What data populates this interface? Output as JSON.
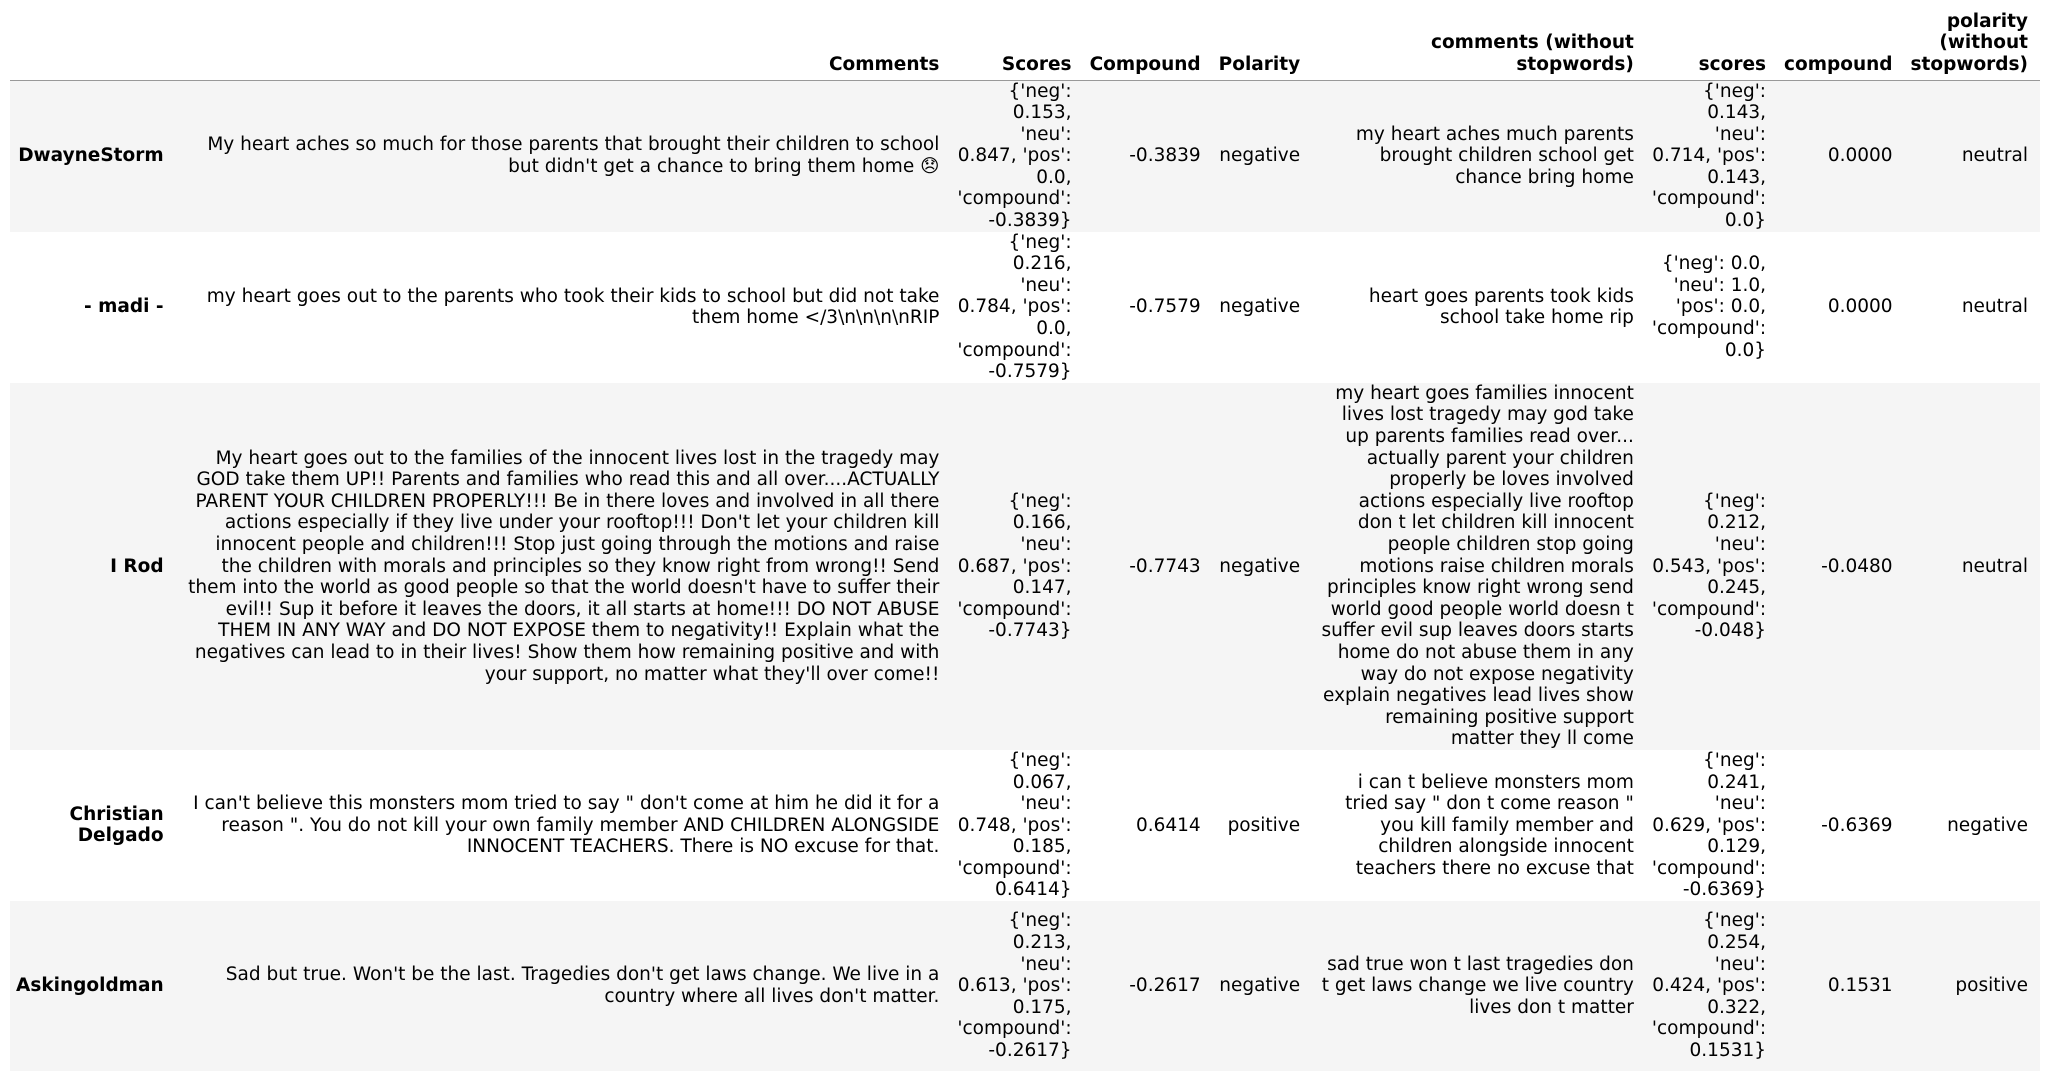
{
  "table": {
    "columns": [
      "Comments",
      "Scores",
      "Compound",
      "Polarity",
      "comments (without stopwords)",
      "scores",
      "compound",
      "polarity (without stopwords)"
    ],
    "rows": [
      {
        "index": "DwayneStorm",
        "comments": "My heart aches so much for those parents that brought their children to school but didn't get a chance to bring them home 😞",
        "scores": "{'neg': 0.153, 'neu': 0.847, 'pos': 0.0, 'compound': -0.3839}",
        "compound": "-0.3839",
        "polarity": "negative",
        "comments_ws": "my heart aches much parents brought children school get chance bring home",
        "scores_ws": "{'neg': 0.143, 'neu': 0.714, 'pos': 0.143, 'compound': 0.0}",
        "compound_ws": "0.0000",
        "polarity_ws": "neutral"
      },
      {
        "index": "- madi -",
        "comments": "my heart goes out to the parents who took their kids to school but did not take them home </3\\n\\n\\n\\nRIP",
        "scores": "{'neg': 0.216, 'neu': 0.784, 'pos': 0.0, 'compound': -0.7579}",
        "compound": "-0.7579",
        "polarity": "negative",
        "comments_ws": "heart goes parents took kids school take home rip",
        "scores_ws": "{'neg': 0.0, 'neu': 1.0, 'pos': 0.0, 'compound': 0.0}",
        "compound_ws": "0.0000",
        "polarity_ws": "neutral"
      },
      {
        "index": "I Rod",
        "comments": "My heart goes out to the families of the innocent lives lost in the tragedy may GOD take them UP!! Parents and families who read this and all over....ACTUALLY PARENT YOUR CHILDREN PROPERLY!!! Be in there loves and involved in all there actions especially if they live under your rooftop!!! Don't let your children kill innocent people and children!!! Stop just going through the motions and raise the children with morals and principles so they know right from wrong!! Send them into the world as good people so that the world doesn't have to suffer their evil!! Sup it before it leaves the doors, it all starts at home!!! DO NOT ABUSE THEM IN ANY WAY and DO NOT EXPOSE them to negativity!! Explain what the negatives can lead to in their lives! Show them how remaining positive and with your support, no matter what they'll over come!!",
        "scores": "{'neg': 0.166, 'neu': 0.687, 'pos': 0.147, 'compound': -0.7743}",
        "compound": "-0.7743",
        "polarity": "negative",
        "comments_ws": "my heart goes families innocent lives lost tragedy may god take up parents families read over... actually parent your children properly be loves involved actions especially live rooftop don t let children kill innocent people children stop going motions raise children morals principles know right wrong send world good people world doesn t suffer evil sup leaves doors starts home do not abuse them in any way do not expose negativity explain negatives lead lives show remaining positive support matter they ll come",
        "scores_ws": "{'neg': 0.212, 'neu': 0.543, 'pos': 0.245, 'compound': -0.048}",
        "compound_ws": "-0.0480",
        "polarity_ws": "neutral"
      },
      {
        "index": "Christian Delgado",
        "comments": "I can't believe this monsters mom tried to say \" don't come at him he did it for a reason \". You do not kill your own family member AND CHILDREN ALONGSIDE INNOCENT TEACHERS. There is NO excuse for that.",
        "scores": "{'neg': 0.067, 'neu': 0.748, 'pos': 0.185, 'compound': 0.6414}",
        "compound": "0.6414",
        "polarity": "positive",
        "comments_ws": "i can t believe monsters mom tried say \" don t come reason \" you kill family member and children alongside innocent teachers there no excuse that",
        "scores_ws": "{'neg': 0.241, 'neu': 0.629, 'pos': 0.129, 'compound': -0.6369}",
        "compound_ws": "-0.6369",
        "polarity_ws": "negative"
      },
      {
        "index": "Askingoldman",
        "comments": "Sad but true. Won't be the last. Tragedies don't get laws change. We live in a country where all lives don't matter.",
        "scores": "{'neg': 0.213, 'neu': 0.613, 'pos': 0.175, 'compound': -0.2617}",
        "compound": "-0.2617",
        "polarity": "negative",
        "comments_ws": "sad true won t last tragedies don t get laws change we live country lives don t matter",
        "scores_ws": "{'neg': 0.254, 'neu': 0.424, 'pos': 0.322, 'compound': 0.1531}",
        "compound_ws": "0.1531",
        "polarity_ws": "positive"
      }
    ]
  }
}
